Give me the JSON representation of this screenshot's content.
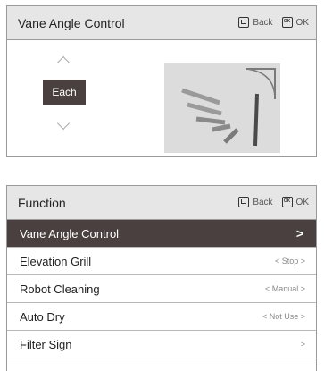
{
  "vane_panel": {
    "title": "Vane Angle Control",
    "back_label": "Back",
    "ok_label": "OK",
    "ok_icon_text": "OK",
    "selector_value": "Each"
  },
  "function_panel": {
    "title": "Function",
    "back_label": "Back",
    "ok_label": "OK",
    "ok_icon_text": "OK",
    "items": [
      {
        "label": "Vane Angle Control",
        "value": ">",
        "selected": true
      },
      {
        "label": "Elevation Grill",
        "value": "< Stop >"
      },
      {
        "label": "Robot Cleaning",
        "value": "< Manual >"
      },
      {
        "label": "Auto Dry",
        "value": "< Not Use >"
      },
      {
        "label": "Filter Sign",
        "value": ">"
      }
    ]
  },
  "icons": [
    "back-icon",
    "ok-icon",
    "chevron-up-icon",
    "chevron-down-icon",
    "vane-illustration-icon"
  ],
  "colors": {
    "header_bg": "#e6e6e6",
    "selected_bg": "#4a4040",
    "border": "#9a9a9a"
  }
}
